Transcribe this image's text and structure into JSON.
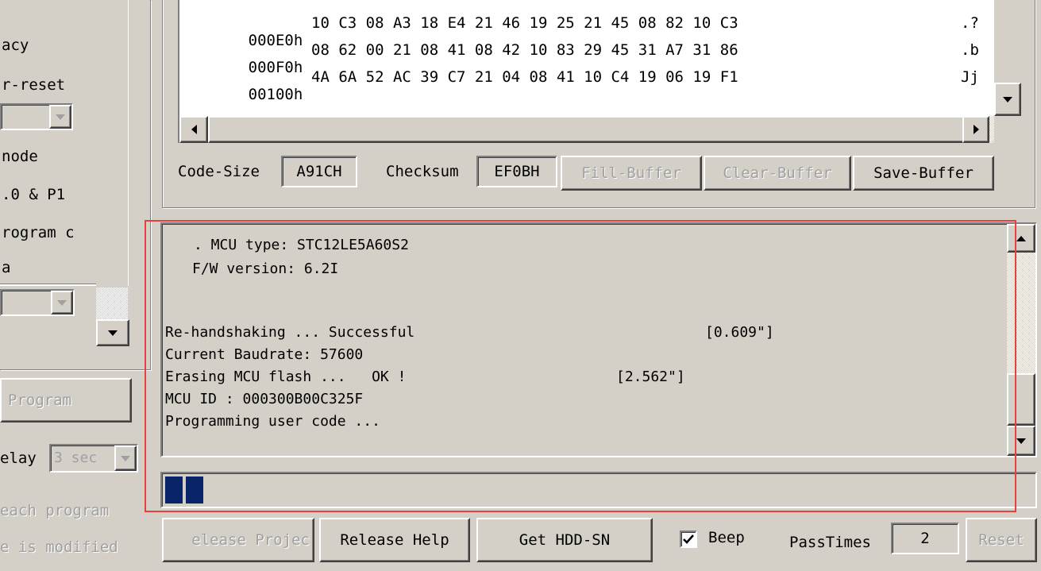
{
  "left_panel": {
    "labels": [
      "acy",
      "r-reset",
      "node",
      ".0 & P1",
      "rogram c",
      "a"
    ],
    "combo1_value": "",
    "combo2_value": "",
    "program_button": "Program",
    "delay_label": "elay",
    "delay_value": "3 sec",
    "each_program": "each program",
    "is_modified": "e is modified"
  },
  "hex_view": {
    "rows": [
      {
        "addr": "000E0h",
        "bytes": "10 C3 08 A3 18 E4 21 46 19 25 21 45 08 82 10 C3",
        "ascii": ".?"
      },
      {
        "addr": "000F0h",
        "bytes": "08 62 00 21 08 41 08 42 10 83 29 45 31 A7 31 86",
        "ascii": ".b"
      },
      {
        "addr": "00100h",
        "bytes": "4A 6A 52 AC 39 C7 21 04 08 41 10 C4 19 06 19 F1",
        "ascii": "Jj"
      }
    ]
  },
  "buffer_bar": {
    "code_size_label": "Code-Size",
    "code_size_value": "A91CH",
    "checksum_label": "Checksum",
    "checksum_value": "EF0BH",
    "fill_buffer": "Fill-Buffer",
    "clear_buffer": "Clear-Buffer",
    "save_buffer": "Save-Buffer"
  },
  "log": {
    "lines": [
      {
        "text": ". MCU type: STC12LE5A60S2"
      },
      {
        "text": "F/W version: 6.2I"
      },
      {
        "text": "Re-handshaking ... Successful"
      },
      {
        "text": "Current Baudrate: 57600"
      },
      {
        "text": "Erasing MCU flash ...   OK !"
      },
      {
        "text": "MCU ID : 000300B00C325F"
      },
      {
        "text": "Programming user code ..."
      }
    ],
    "times": [
      "[0.609\"]",
      "[2.562\"]"
    ]
  },
  "progress": {
    "filled_blocks": 2,
    "color": "#0A246A"
  },
  "bottom_bar": {
    "release_project": "elease Projec",
    "release_help": "Release Help",
    "get_hdd_sn": "Get HDD-SN",
    "beep_label": "Beep",
    "beep_checked": true,
    "pass_times_label": "PassTimes",
    "pass_times_value": "2",
    "reset": "Reset"
  },
  "highlight_color": "#E84040"
}
